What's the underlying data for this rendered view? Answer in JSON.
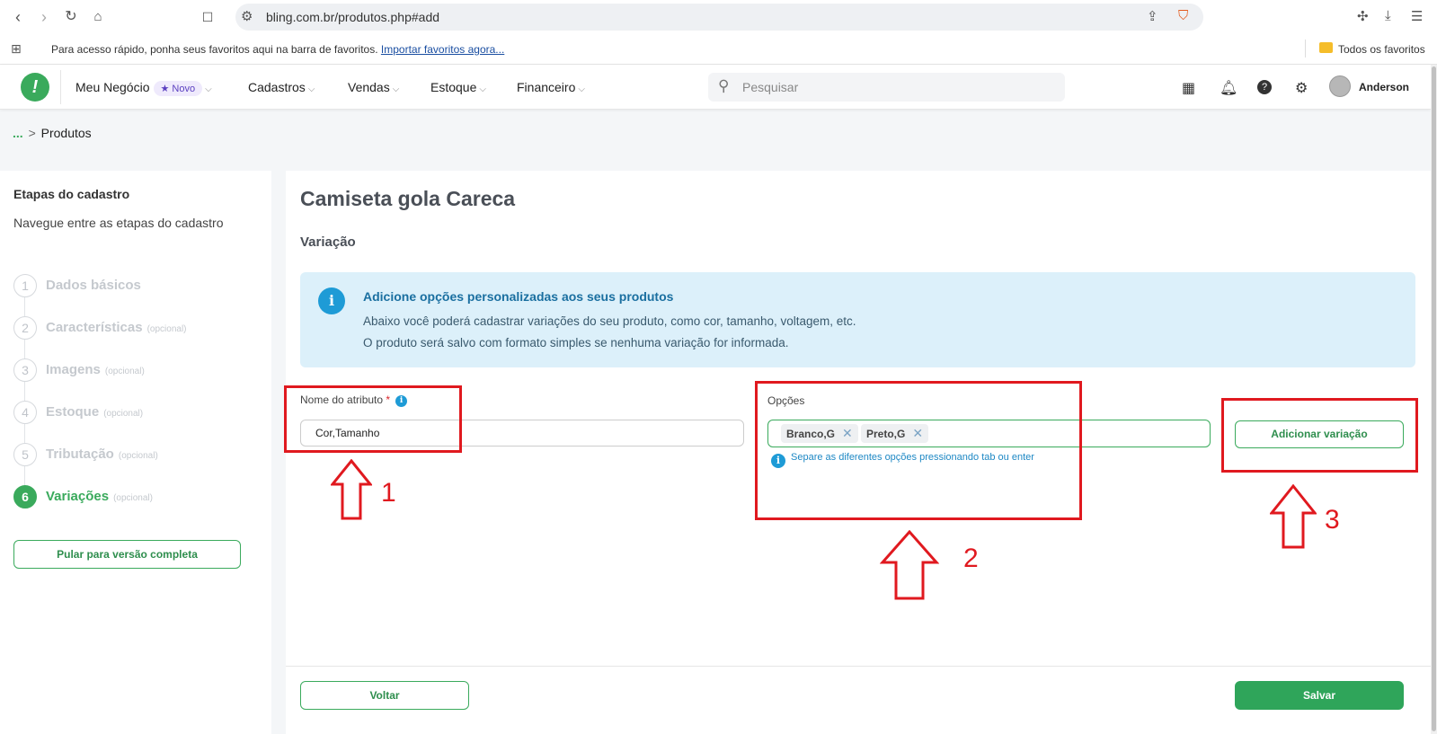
{
  "browser": {
    "url": "bling.com.br/produtos.php#add",
    "bookmarks_hint": "Para acesso rápido, ponha seus favoritos aqui na barra de favoritos.",
    "bookmarks_link": "Importar favoritos agora...",
    "all_bookmarks": "Todos os favoritos"
  },
  "header": {
    "menu": [
      {
        "label": "Meu Negócio"
      },
      {
        "label": "Cadastros"
      },
      {
        "label": "Vendas"
      },
      {
        "label": "Estoque"
      },
      {
        "label": "Financeiro"
      }
    ],
    "badge": "★ Novo",
    "search_placeholder": "Pesquisar",
    "user": "Anderson"
  },
  "breadcrumb": {
    "dots": "...",
    "separator": ">",
    "current": "Produtos"
  },
  "sidebar": {
    "title": "Etapas do cadastro",
    "subtitle": "Navegue entre as etapas do cadastro",
    "steps": [
      {
        "num": "1",
        "label": "Dados básicos",
        "optional": ""
      },
      {
        "num": "2",
        "label": "Características",
        "optional": "(opcional)"
      },
      {
        "num": "3",
        "label": "Imagens",
        "optional": "(opcional)"
      },
      {
        "num": "4",
        "label": "Estoque",
        "optional": "(opcional)"
      },
      {
        "num": "5",
        "label": "Tributação",
        "optional": "(opcional)"
      },
      {
        "num": "6",
        "label": "Variações",
        "optional": "(opcional)"
      }
    ],
    "skip_button": "Pular para versão completa"
  },
  "main": {
    "product_title": "Camiseta gola Careca",
    "section_title": "Variação",
    "info": {
      "title": "Adicione opções personalizadas aos seus produtos",
      "line1": "Abaixo você poderá cadastrar variações do seu produto, como cor, tamanho, voltagem, etc.",
      "line2": "O produto será salvo com formato simples se nenhuma variação for informada."
    },
    "attribute_label": "Nome do atributo",
    "attribute_required": "*",
    "attribute_value": "Cor,Tamanho",
    "options_label": "Opções",
    "options": [
      "Branco,G",
      "Preto,G"
    ],
    "options_hint": "Separe as diferentes opções pressionando tab ou enter",
    "add_variation_button": "Adicionar variação",
    "back_button": "Voltar",
    "save_button": "Salvar"
  },
  "annotations": [
    "1",
    "2",
    "3"
  ],
  "colors": {
    "brand_green": "#3aaa5c",
    "annotation_red": "#e0191f",
    "info_bg": "#dcf0fa"
  }
}
